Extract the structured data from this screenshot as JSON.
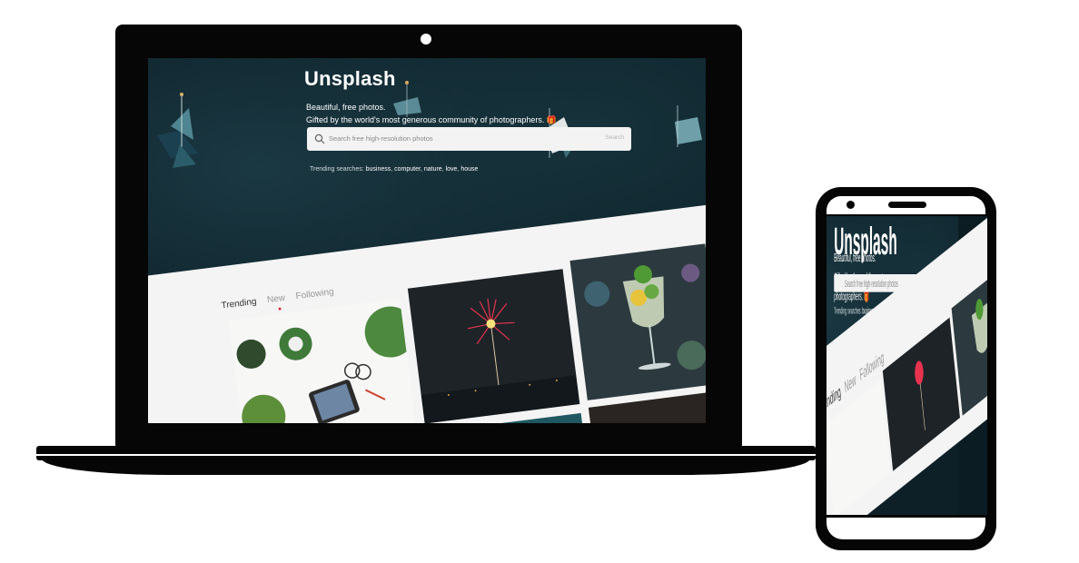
{
  "brand": "Unsplash",
  "tagline_line1": "Beautiful, free photos.",
  "tagline_line2": "Gifted by the world's most generous community of photographers. 🎁",
  "search": {
    "placeholder": "Search free high-resolution photos",
    "button_label": "Search"
  },
  "trending": {
    "label": "Trending searches:",
    "terms": [
      "business",
      "computer",
      "nature",
      "love",
      "house"
    ]
  },
  "tabs": [
    "Trending",
    "New",
    "Following"
  ],
  "active_tab": "Trending",
  "colors": {
    "hero_background": "#0d2028",
    "content_background": "#f4f4f4",
    "device_frame": "#060606",
    "tab_indicator": "#e0283a"
  }
}
